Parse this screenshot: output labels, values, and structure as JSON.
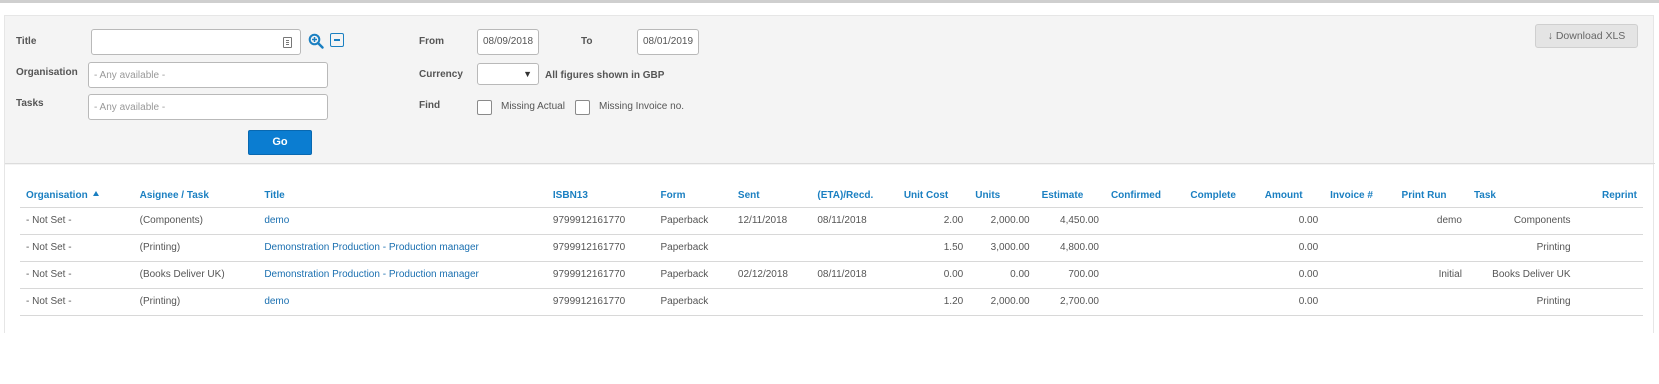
{
  "filters": {
    "title_label": "Title",
    "title_value": "",
    "organisation_label": "Organisation",
    "organisation_placeholder": "- Any available -",
    "tasks_label": "Tasks",
    "tasks_placeholder": "- Any available -",
    "go_label": "Go",
    "from_label": "From",
    "from_value": "08/09/2018",
    "to_label": "To",
    "to_value": "08/01/2019",
    "currency_label": "Currency",
    "currency_value": "",
    "currency_note": "All figures shown in GBP",
    "find_label": "Find",
    "missing_actual_label": "Missing Actual",
    "missing_invoice_label": "Missing Invoice no."
  },
  "toolbar": {
    "download_label": "↓ Download XLS"
  },
  "icons": {
    "card": "contact-card-icon",
    "zoom": "zoom-in-icon",
    "collapse": "minus-box-icon",
    "sort": "sort-asc-icon"
  },
  "colors": {
    "accent": "#0b7dd1",
    "link": "#1a7fc1"
  },
  "table": {
    "columns": [
      "Organisation",
      "Asignee / Task",
      "Title",
      "ISBN13",
      "Form",
      "Sent",
      "(ETA)/Recd.",
      "Unit Cost",
      "Units",
      "Estimate",
      "Confirmed",
      "Complete",
      "Amount",
      "Invoice #",
      "Print Run",
      "Task",
      "Reprint"
    ],
    "sorted_column": "Organisation",
    "rows": [
      {
        "organisation": "- Not Set -",
        "assignee": "(Components)",
        "title": "demo",
        "isbn": "9799912161770",
        "form": "Paperback",
        "sent": "12/11/2018",
        "recd": "08/11/2018",
        "unit_cost": "2.00",
        "units": "2,000.00",
        "estimate": "4,450.00",
        "confirmed": "",
        "complete": "",
        "amount": "0.00",
        "invoice": "",
        "print_run": "demo",
        "task": "Components",
        "reprint": ""
      },
      {
        "organisation": "- Not Set -",
        "assignee": "(Printing)",
        "title": "Demonstration Production - Production manager",
        "isbn": "9799912161770",
        "form": "Paperback",
        "sent": "",
        "recd": "",
        "unit_cost": "1.50",
        "units": "3,000.00",
        "estimate": "4,800.00",
        "confirmed": "",
        "complete": "",
        "amount": "0.00",
        "invoice": "",
        "print_run": "",
        "task": "Printing",
        "reprint": ""
      },
      {
        "organisation": "- Not Set -",
        "assignee": "(Books Deliver UK)",
        "title": "Demonstration Production - Production manager",
        "isbn": "9799912161770",
        "form": "Paperback",
        "sent": "02/12/2018",
        "recd": "08/11/2018",
        "unit_cost": "0.00",
        "units": "0.00",
        "estimate": "700.00",
        "confirmed": "",
        "complete": "",
        "amount": "0.00",
        "invoice": "",
        "print_run": "Initial",
        "task": "Books Deliver UK",
        "reprint": ""
      },
      {
        "organisation": "- Not Set -",
        "assignee": "(Printing)",
        "title": "demo",
        "isbn": "9799912161770",
        "form": "Paperback",
        "sent": "",
        "recd": "",
        "unit_cost": "1.20",
        "units": "2,000.00",
        "estimate": "2,700.00",
        "confirmed": "",
        "complete": "",
        "amount": "0.00",
        "invoice": "",
        "print_run": "",
        "task": "Printing",
        "reprint": ""
      }
    ]
  }
}
